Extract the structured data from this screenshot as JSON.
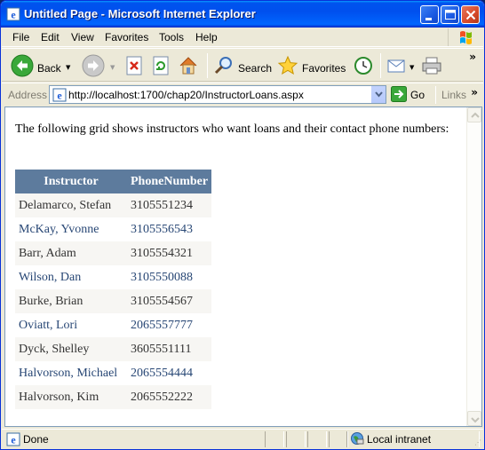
{
  "window": {
    "title": "Untitled Page - Microsoft Internet Explorer"
  },
  "menu": {
    "items": [
      "File",
      "Edit",
      "View",
      "Favorites",
      "Tools",
      "Help"
    ]
  },
  "toolbar": {
    "back_label": "Back",
    "search_label": "Search",
    "favorites_label": "Favorites",
    "overflow_label": "»"
  },
  "address": {
    "label": "Address",
    "url": "http://localhost:1700/chap20/InstructorLoans.aspx",
    "go_label": "Go",
    "links_label": "Links"
  },
  "page": {
    "intro": "The following grid shows instructors who want loans and their contact phone numbers:",
    "grid": {
      "columns": [
        "Instructor",
        "PhoneNumber"
      ],
      "rows": [
        [
          "Delamarco, Stefan",
          "3105551234"
        ],
        [
          "McKay, Yvonne",
          "3105556543"
        ],
        [
          "Barr, Adam",
          "3105554321"
        ],
        [
          "Wilson, Dan",
          "3105550088"
        ],
        [
          "Burke, Brian",
          "3105554567"
        ],
        [
          "Oviatt, Lori",
          "2065557777"
        ],
        [
          "Dyck, Shelley",
          "3605551111"
        ],
        [
          "Halvorson, Michael",
          "2065554444"
        ],
        [
          "Halvorson, Kim",
          "2065552222"
        ]
      ]
    }
  },
  "status": {
    "text": "Done",
    "zone": "Local intranet"
  },
  "colors": {
    "grid_header": "#5d7b9d",
    "grid_row_odd": "#f7f6f3",
    "grid_row_even": "#ffffff",
    "grid_text_odd": "#333333",
    "grid_text_even": "#284775"
  }
}
